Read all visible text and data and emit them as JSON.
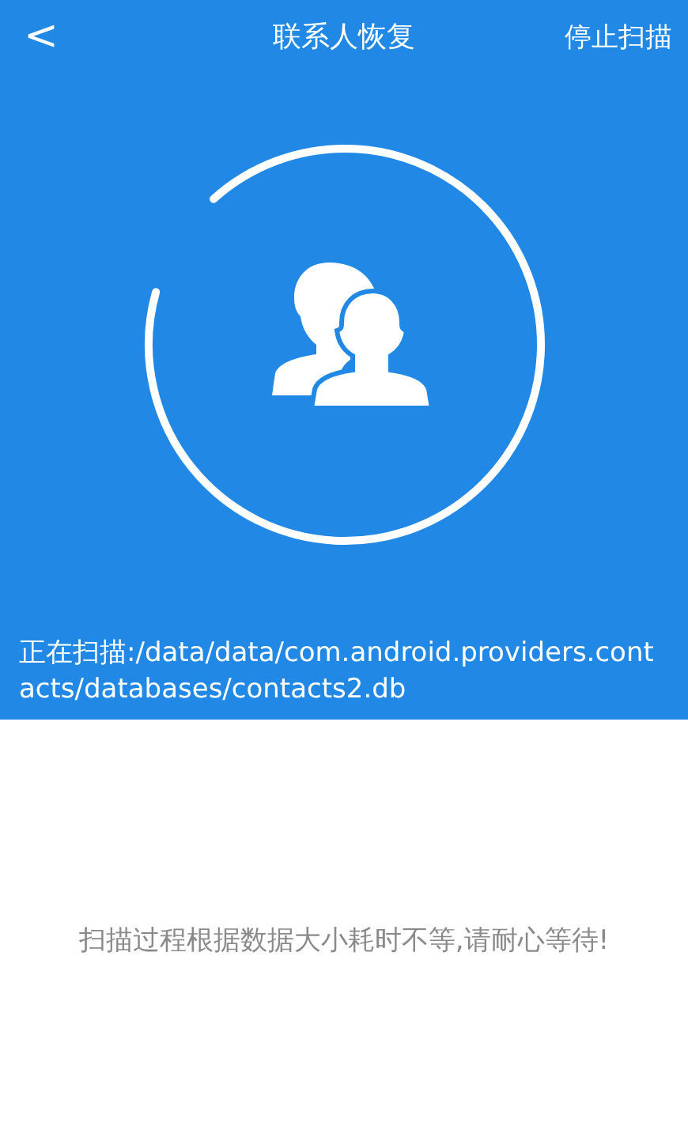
{
  "header": {
    "back": "<",
    "title": "联系人恢复",
    "action": "停止扫描"
  },
  "scan": {
    "level": 0.91,
    "status": "正在扫描:/data/data/com.android.providers.contacts/databases/contacts2.db"
  },
  "hint": "扫描过程根据数据大小耗时不等,请耐心等待!"
}
